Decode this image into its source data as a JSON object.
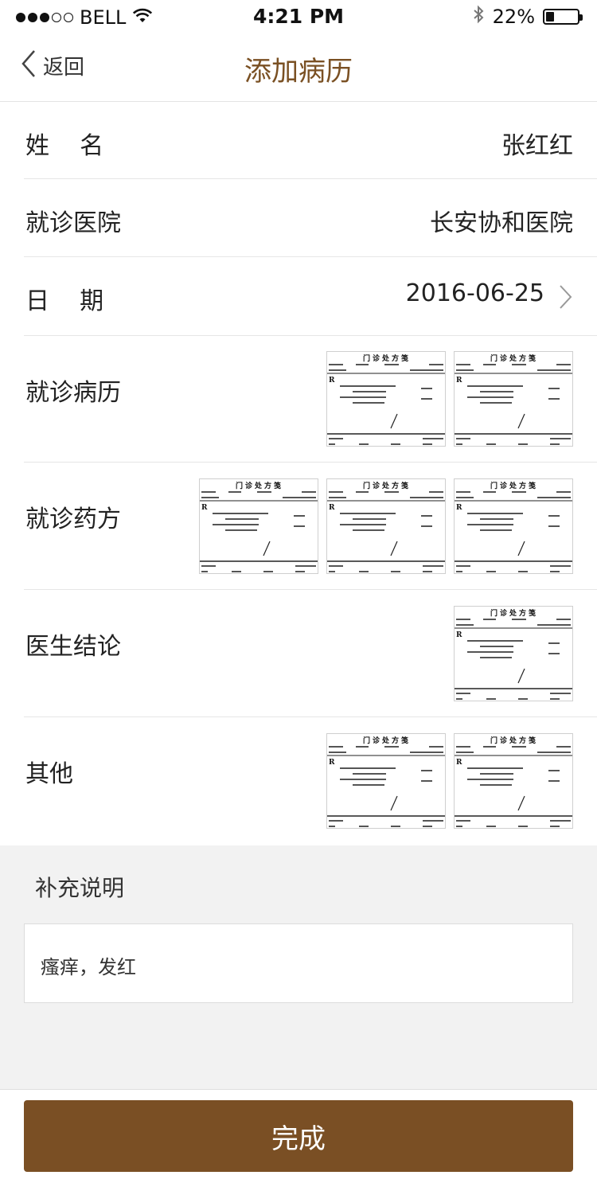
{
  "status_bar": {
    "carrier": "BELL",
    "time": "4:21 PM",
    "battery_percent": "22%",
    "battery_level": 0.22,
    "signal_bars_filled": 3,
    "signal_bars_total": 5,
    "icons": [
      "wifi-icon",
      "bluetooth-icon",
      "battery-icon"
    ]
  },
  "nav": {
    "back_label": "返回",
    "title": "添加病历"
  },
  "form": {
    "name_label": "姓    名",
    "name_value": "张红红",
    "hospital_label": "就诊医院",
    "hospital_value": "长安协和医院",
    "date_label": "日    期",
    "date_value": "2016-06-25",
    "records_label": "就诊病历",
    "prescriptions_label": "就诊药方",
    "conclusion_label": "医生结论",
    "other_label": "其他"
  },
  "attachments": {
    "records_count": 2,
    "prescriptions_count": 3,
    "conclusion_count": 1,
    "other_count": 2,
    "slip_title": "门诊处方笺"
  },
  "supplement": {
    "title": "补充说明",
    "value": "瘙痒，发红"
  },
  "footer": {
    "done_label": "完成"
  },
  "colors": {
    "accent": "#7a4f24",
    "title": "#7a5023",
    "section_bg": "#f2f2f2"
  }
}
